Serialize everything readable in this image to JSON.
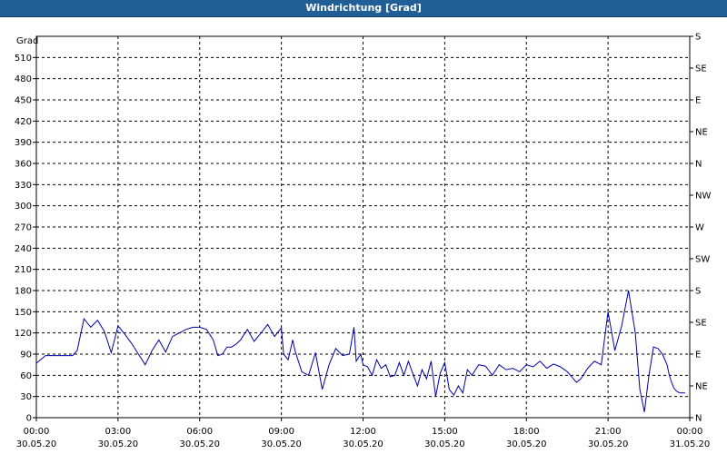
{
  "window": {
    "title": "Windrichtung [Grad]"
  },
  "chart_data": {
    "type": "line",
    "title": "Windrichtung [Grad]",
    "ylabel": "Grad",
    "xlabel": "",
    "ylim": [
      0,
      540
    ],
    "xlim": [
      "2020-05-30 00:00",
      "2020-05-31 00:00"
    ],
    "grid": true,
    "y_ticks_left": [
      0,
      30,
      60,
      90,
      120,
      150,
      180,
      210,
      240,
      270,
      300,
      330,
      360,
      390,
      420,
      450,
      480,
      510
    ],
    "y_ticks_right": [
      {
        "value": 0,
        "label": "N"
      },
      {
        "value": 45,
        "label": "NE"
      },
      {
        "value": 90,
        "label": "E"
      },
      {
        "value": 135,
        "label": "SE"
      },
      {
        "value": 180,
        "label": "S"
      },
      {
        "value": 225,
        "label": "SW"
      },
      {
        "value": 270,
        "label": "W"
      },
      {
        "value": 315,
        "label": "NW"
      },
      {
        "value": 360,
        "label": "N"
      },
      {
        "value": 405,
        "label": "NE"
      },
      {
        "value": 450,
        "label": "E"
      },
      {
        "value": 495,
        "label": "SE"
      },
      {
        "value": 540,
        "label": "S"
      }
    ],
    "x_ticks": [
      {
        "time": "00:00",
        "date": "30.05.20"
      },
      {
        "time": "03:00",
        "date": "30.05.20"
      },
      {
        "time": "06:00",
        "date": "30.05.20"
      },
      {
        "time": "09:00",
        "date": "30.05.20"
      },
      {
        "time": "12:00",
        "date": "30.05.20"
      },
      {
        "time": "15:00",
        "date": "30.05.20"
      },
      {
        "time": "18:00",
        "date": "30.05.20"
      },
      {
        "time": "21:00",
        "date": "30.05.20"
      },
      {
        "time": "00:00",
        "date": "31.05.20"
      }
    ],
    "line_color": "#0000aa",
    "series": [
      {
        "x": [
          "00:00",
          "00:20",
          "00:40",
          "01:00",
          "01:20",
          "01:30",
          "01:45",
          "02:00",
          "02:15",
          "02:30",
          "02:45",
          "03:00",
          "03:15",
          "03:30",
          "03:45",
          "04:00",
          "04:15",
          "04:30",
          "04:45",
          "05:00",
          "05:15",
          "05:30",
          "05:45",
          "06:00",
          "06:15",
          "06:30",
          "06:40",
          "06:50",
          "07:00",
          "07:10",
          "07:20",
          "07:30",
          "07:45",
          "08:00",
          "08:15",
          "08:30",
          "08:45",
          "09:00",
          "09:05",
          "09:15",
          "09:25",
          "09:30",
          "09:45",
          "10:00",
          "10:15",
          "10:30",
          "10:45",
          "11:00",
          "11:15",
          "11:30",
          "11:40",
          "11:45",
          "11:50",
          "11:55",
          "12:00",
          "12:10",
          "12:20",
          "12:30",
          "12:40",
          "12:50",
          "13:00",
          "13:10",
          "13:20",
          "13:30",
          "13:40",
          "13:50",
          "14:00",
          "14:10",
          "14:20",
          "14:30",
          "14:40",
          "14:50",
          "15:00",
          "15:10",
          "15:20",
          "15:30",
          "15:40",
          "15:50",
          "16:00",
          "16:15",
          "16:30",
          "16:45",
          "17:00",
          "17:15",
          "17:30",
          "17:45",
          "18:00",
          "18:15",
          "18:30",
          "18:45",
          "19:00",
          "19:15",
          "19:30",
          "19:40",
          "19:50",
          "20:00",
          "20:15",
          "20:30",
          "20:45",
          "21:00",
          "21:15",
          "21:30",
          "21:45",
          "22:00",
          "22:10",
          "22:20",
          "22:30",
          "22:40",
          "22:50",
          "23:00",
          "23:10",
          "23:15",
          "23:20",
          "23:25",
          "23:30",
          "23:35",
          "23:40",
          "23:45",
          "23:50"
        ],
        "y": [
          77,
          88,
          88,
          88,
          88,
          95,
          140,
          128,
          138,
          122,
          92,
          130,
          118,
          105,
          90,
          75,
          95,
          110,
          93,
          115,
          120,
          125,
          128,
          128,
          125,
          110,
          88,
          90,
          100,
          100,
          104,
          110,
          125,
          108,
          120,
          132,
          115,
          127,
          90,
          82,
          110,
          95,
          65,
          60,
          92,
          40,
          75,
          98,
          88,
          90,
          128,
          80,
          85,
          90,
          75,
          72,
          60,
          82,
          70,
          75,
          58,
          60,
          78,
          60,
          80,
          62,
          45,
          68,
          55,
          80,
          30,
          63,
          78,
          40,
          32,
          45,
          35,
          68,
          60,
          75,
          73,
          60,
          75,
          68,
          70,
          65,
          75,
          72,
          80,
          70,
          76,
          72,
          65,
          58,
          50,
          55,
          70,
          80,
          75,
          150,
          95,
          130,
          180,
          120,
          40,
          8,
          60,
          100,
          98,
          90,
          75,
          60,
          50,
          42,
          38,
          36,
          35,
          35,
          35
        ]
      }
    ]
  }
}
